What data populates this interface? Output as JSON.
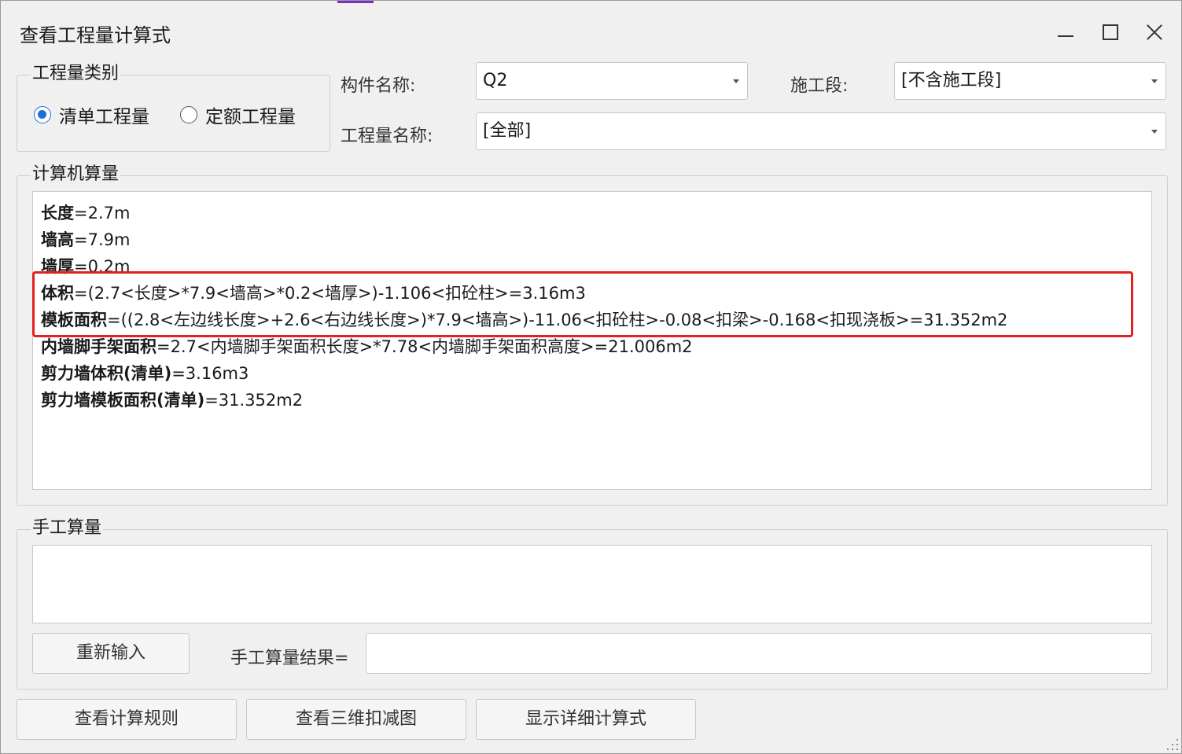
{
  "window": {
    "title": "查看工程量计算式"
  },
  "category_group": {
    "legend": "工程量类别",
    "options": [
      {
        "label": "清单工程量",
        "checked": true
      },
      {
        "label": "定额工程量",
        "checked": false
      }
    ]
  },
  "component": {
    "label": "构件名称:",
    "value": "Q2"
  },
  "segment": {
    "label": "施工段:",
    "value": "[不含施工段]"
  },
  "quantity_name": {
    "label": "工程量名称:",
    "value": "[全部]"
  },
  "computer_group": {
    "legend": "计算机算量",
    "lines": [
      {
        "name": "长度",
        "expr": "=2.7m"
      },
      {
        "name": "墙高",
        "expr": "=7.9m"
      },
      {
        "name": "墙厚",
        "expr": "=0.2m"
      },
      {
        "name": "体积",
        "expr": "=(2.7<长度>*7.9<墙高>*0.2<墙厚>)-1.106<扣砼柱>=3.16m3"
      },
      {
        "name": "模板面积",
        "expr": "=((2.8<左边线长度>+2.6<右边线长度>)*7.9<墙高>)-11.06<扣砼柱>-0.08<扣梁>-0.168<扣现浇板>=31.352m2"
      },
      {
        "name": "内墙脚手架面积",
        "expr": "=2.7<内墙脚手架面积长度>*7.78<内墙脚手架面积高度>=21.006m2"
      },
      {
        "name": "剪力墙体积(清单)",
        "expr": "=3.16m3"
      },
      {
        "name": "剪力墙模板面积(清单)",
        "expr": "=31.352m2"
      }
    ],
    "highlight_color": "#e62020"
  },
  "manual_group": {
    "legend": "手工算量",
    "reset_button": "重新输入",
    "result_label": "手工算量结果=",
    "result_value": ""
  },
  "buttons": {
    "view_rules": "查看计算规则",
    "view_3d": "查看三维扣减图",
    "show_detail": "显示详细计算式"
  },
  "colors": {
    "accent": "#1e6fd9",
    "highlight": "#e62020"
  }
}
